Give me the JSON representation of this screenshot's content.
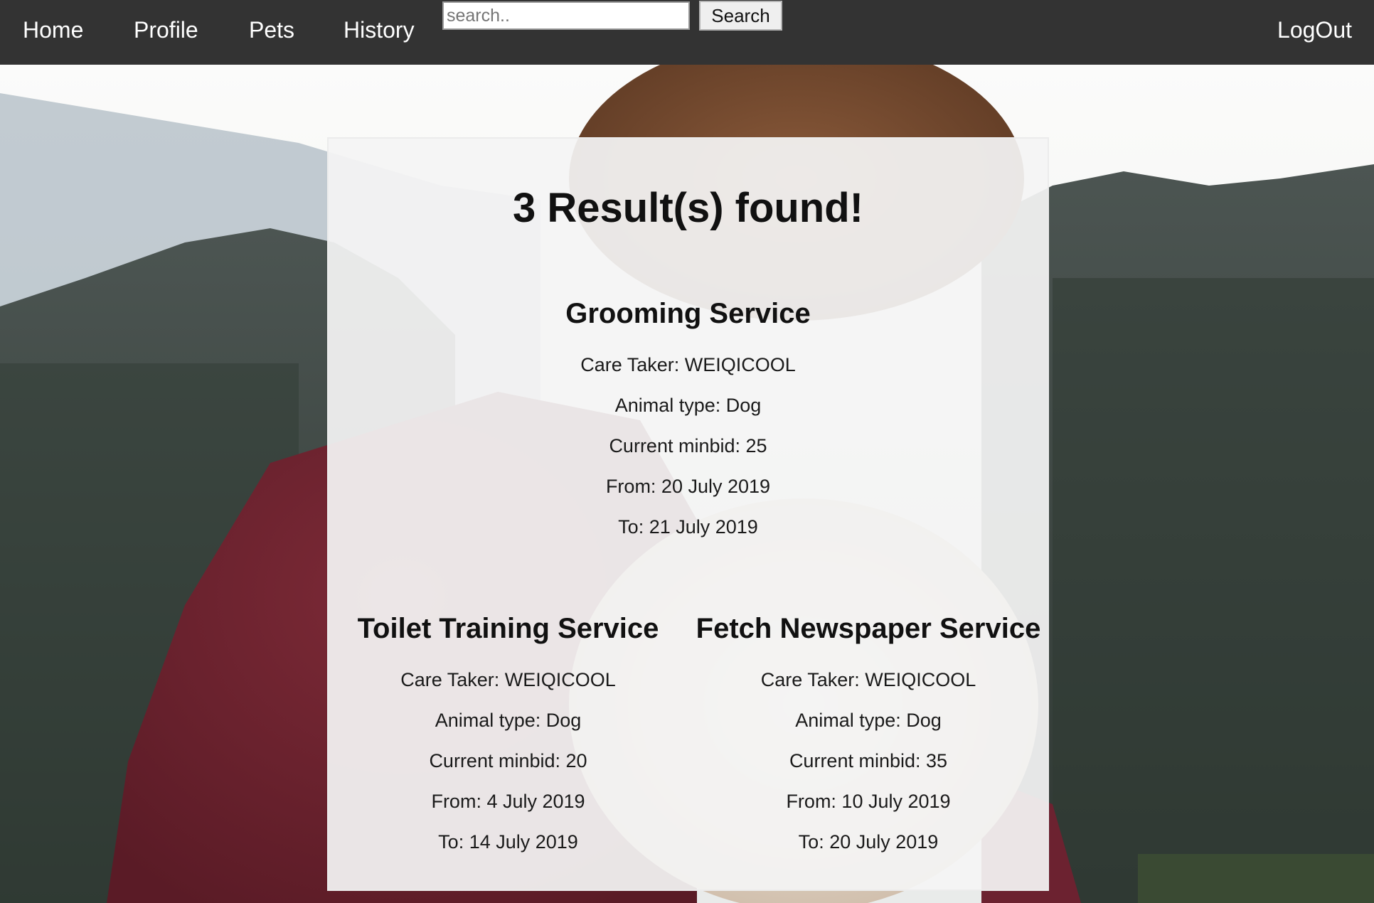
{
  "nav": {
    "home": "Home",
    "profile": "Profile",
    "pets": "Pets",
    "history": "History",
    "logout": "LogOut"
  },
  "search": {
    "placeholder": "search..",
    "value": "",
    "button_label": "Search"
  },
  "results": {
    "heading": "3 Result(s) found!",
    "items": [
      {
        "title": "Grooming Service",
        "care_taker": "Care Taker: WEIQICOOL",
        "animal_type": "Animal type: Dog",
        "current_minbid": "Current minbid: 25",
        "from": "From: 20 July 2019",
        "to": "To: 21 July 2019"
      },
      {
        "title": "Toilet Training Service",
        "care_taker": "Care Taker: WEIQICOOL",
        "animal_type": "Animal type: Dog",
        "current_minbid": "Current minbid: 20",
        "from": "From: 4 July 2019",
        "to": "To: 14 July 2019"
      },
      {
        "title": "Fetch Newspaper Service",
        "care_taker": "Care Taker: WEIQICOOL",
        "animal_type": "Animal type: Dog",
        "current_minbid": "Current minbid: 35",
        "from": "From: 10 July 2019",
        "to": "To: 20 July 2019"
      }
    ]
  },
  "colors": {
    "navbar": "#333333",
    "nav_text": "#ffffff",
    "panel": "#f4f4f4",
    "text": "#111111"
  }
}
